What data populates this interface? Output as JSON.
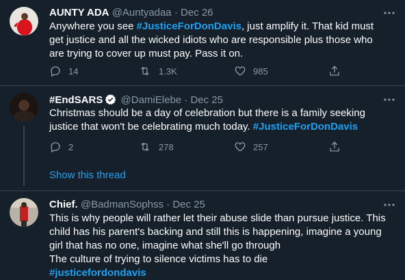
{
  "colors": {
    "background": "#15202b",
    "text": "#ffffff",
    "secondary": "#8899a6",
    "accent": "#1da1f2",
    "divider": "#38444d",
    "verified": "#ffffff"
  },
  "tweets": [
    {
      "display_name": "AUNTY ADA",
      "handle": "@Auntyadaa",
      "separator": "·",
      "date": "Dec 26",
      "lines": [
        [
          {
            "text": "Anywhere you see "
          },
          {
            "text": "#JusticeForDonDavis",
            "tag": true
          },
          {
            "text": ", just amplify it. That kid must"
          }
        ],
        [
          {
            "text": "get justice and all the wicked idiots who are responsible plus those who"
          }
        ],
        [
          {
            "text": "are trying to cover up must pay. Pass it on."
          }
        ]
      ],
      "replies": "14",
      "retweets": "1.3K",
      "likes": "985"
    },
    {
      "display_name": "#EndSARS",
      "verified": true,
      "handle": "@DamiElebe",
      "separator": "·",
      "date": "Dec 25",
      "lines": [
        [
          {
            "text": "Christmas should be a day of celebration but there is a family seeking"
          }
        ],
        [
          {
            "text": "justice that won't be celebrating much today.  "
          },
          {
            "text": "#JusticeForDonDavis",
            "tag": true
          }
        ]
      ],
      "replies": "2",
      "retweets": "278",
      "likes": "257"
    },
    {
      "display_name": "Chief.",
      "handle": "@BadmanSophss",
      "separator": "·",
      "date": "Dec 25",
      "lines": [
        [
          {
            "text": "This is why people will rather let their abuse slide than pursue justice. This"
          }
        ],
        [
          {
            "text": "child has his parent's backing and still this is happening, imagine a young"
          }
        ],
        [
          {
            "text": "girl that has no one, imagine what she'll go through"
          }
        ],
        [
          {
            "text": "The culture of trying to silence victims has to die"
          }
        ],
        [
          {
            "text": "#justicefordondavis",
            "tag": true
          }
        ]
      ]
    }
  ],
  "show_thread_label": "Show this thread"
}
